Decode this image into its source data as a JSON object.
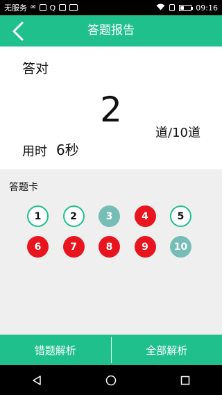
{
  "status_bar": {
    "carrier": "无服务",
    "time": "09:16",
    "icons": [
      "signal-icon",
      "sim-icon",
      "qq-icon",
      "gallery-icon",
      "sd-card-icon",
      "wifi-icon",
      "battery-icon"
    ]
  },
  "header": {
    "title": "答题报告"
  },
  "result": {
    "correct_label": "答对",
    "score": "2",
    "score_unit": "道/10道",
    "time_label": "用时",
    "time_value": "6秒"
  },
  "answer_card": {
    "title": "答题卡",
    "items": [
      {
        "label": "1",
        "status": "correct"
      },
      {
        "label": "2",
        "status": "correct"
      },
      {
        "label": "3",
        "status": "unanswered"
      },
      {
        "label": "4",
        "status": "wrong"
      },
      {
        "label": "5",
        "status": "correct"
      },
      {
        "label": "6",
        "status": "wrong"
      },
      {
        "label": "7",
        "status": "wrong"
      },
      {
        "label": "8",
        "status": "wrong"
      },
      {
        "label": "9",
        "status": "wrong"
      },
      {
        "label": "10",
        "status": "unanswered"
      }
    ]
  },
  "footer": {
    "wrong_analysis_label": "错题解析",
    "all_analysis_label": "全部解析"
  },
  "colors": {
    "accent": "#20c08d",
    "wrong": "#e8141e",
    "unanswered": "#75bdb6"
  }
}
